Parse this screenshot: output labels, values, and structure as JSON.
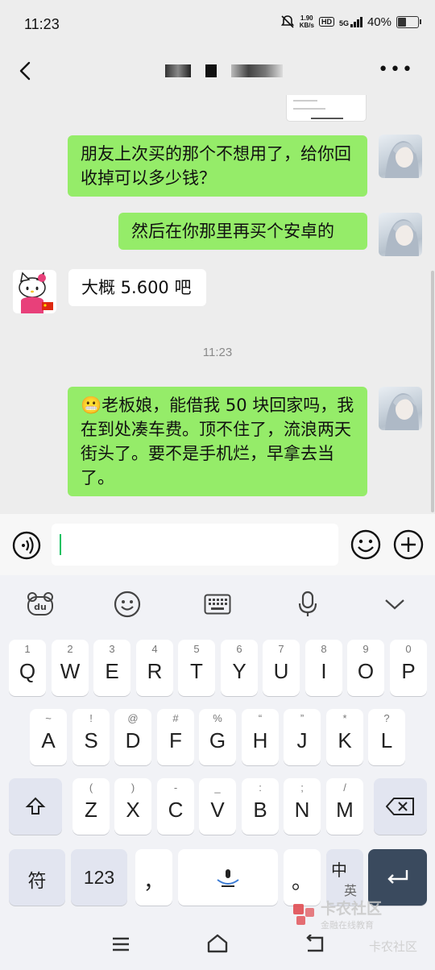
{
  "status_bar": {
    "time": "11:23",
    "net_speed_top": "1.90",
    "net_speed_bottom": "KB/s",
    "hd": "HD",
    "signal": "5G",
    "battery": "40%"
  },
  "header": {
    "back_icon": "chevron-left-icon",
    "more_label": "•••"
  },
  "messages": [
    {
      "side": "right",
      "text": "朋友上次买的那个不想用了，给你回收掉可以多少钱？"
    },
    {
      "side": "right",
      "text": "然后在你那里再买个安卓的"
    },
    {
      "side": "left",
      "text": "大概 5.600 吧"
    },
    {
      "type": "time",
      "text": "11:23"
    },
    {
      "side": "right",
      "emoji": "😬",
      "text": "老板娘，能借我 50 块回家吗，我在到处凑车费。顶不住了，流浪两天街头了。要不是手机烂，早拿去当了。"
    }
  ],
  "input": {
    "value": "",
    "voice_icon": "voice-icon",
    "emoji_icon": "smiley-icon",
    "plus_icon": "plus-icon"
  },
  "keyboard": {
    "toolbar": [
      "du-logo-icon",
      "smiley-icon",
      "keyboard-icon",
      "microphone-icon",
      "chevron-down-icon"
    ],
    "row1": [
      {
        "main": "Q",
        "sub": "1"
      },
      {
        "main": "W",
        "sub": "2"
      },
      {
        "main": "E",
        "sub": "3"
      },
      {
        "main": "R",
        "sub": "4"
      },
      {
        "main": "T",
        "sub": "5"
      },
      {
        "main": "Y",
        "sub": "6"
      },
      {
        "main": "U",
        "sub": "7"
      },
      {
        "main": "I",
        "sub": "8"
      },
      {
        "main": "O",
        "sub": "9"
      },
      {
        "main": "P",
        "sub": "0"
      }
    ],
    "row2": [
      {
        "main": "A",
        "sub": "~"
      },
      {
        "main": "S",
        "sub": "!"
      },
      {
        "main": "D",
        "sub": "@"
      },
      {
        "main": "F",
        "sub": "#"
      },
      {
        "main": "G",
        "sub": "%"
      },
      {
        "main": "H",
        "sub": "“"
      },
      {
        "main": "J",
        "sub": "”"
      },
      {
        "main": "K",
        "sub": "*"
      },
      {
        "main": "L",
        "sub": "?"
      }
    ],
    "row3": [
      {
        "main": "Z",
        "sub": "("
      },
      {
        "main": "X",
        "sub": ")"
      },
      {
        "main": "C",
        "sub": "-"
      },
      {
        "main": "V",
        "sub": "_"
      },
      {
        "main": "B",
        "sub": ":"
      },
      {
        "main": "N",
        "sub": ";"
      },
      {
        "main": "M",
        "sub": "/"
      }
    ],
    "symbol_key": "符",
    "number_key": "123",
    "comma_key": "，",
    "period_key": "。",
    "lang_key_top": "中",
    "lang_key_bottom": "英"
  },
  "watermark": {
    "brand": "卡农社区",
    "slogan": "金融在线教育",
    "corner": "卡农社区"
  },
  "colors": {
    "sent_bubble": "#95ec69",
    "received_bubble": "#ffffff",
    "chat_bg": "#ededed",
    "caret": "#07c160",
    "enter_key": "#3a4a5e"
  }
}
